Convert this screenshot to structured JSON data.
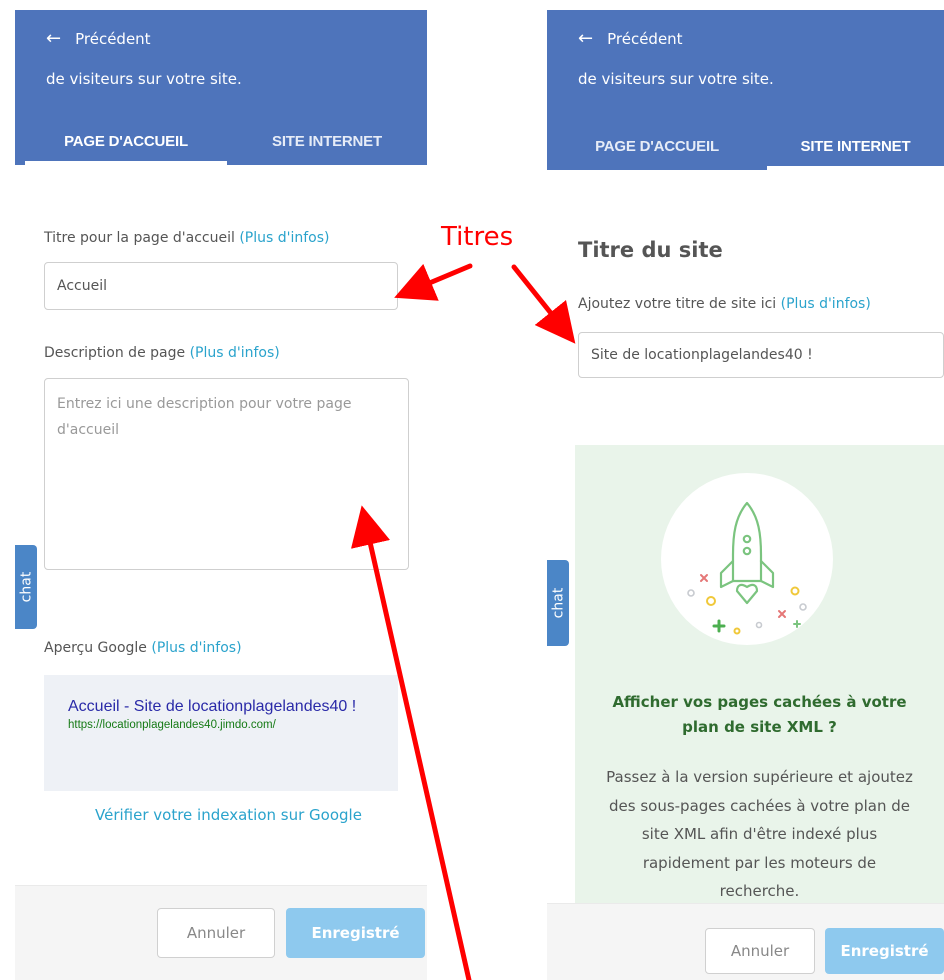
{
  "left": {
    "back_label": "Précédent",
    "header_sub": "de visiteurs sur votre site.",
    "tabs": [
      {
        "label": "PAGE D'ACCUEIL",
        "active": true
      },
      {
        "label": "SITE INTERNET",
        "active": false
      }
    ],
    "title_label": "Titre pour la page d'accueil",
    "more_info": "(Plus d'infos)",
    "title_value": "Accueil",
    "description_label": "Description de page",
    "description_placeholder": "Entrez ici une description pour votre page d'accueil",
    "google_label": "Aperçu Google",
    "google_preview": {
      "title": "Accueil - Site de locationplagelandes40 !",
      "url": "https://locationplagelandes40.jimdo.com/"
    },
    "verify_link": "Vérifier votre indexation sur Google",
    "cancel_label": "Annuler",
    "save_label": "Enregistré"
  },
  "right": {
    "back_label": "Précédent",
    "header_sub": "de visiteurs sur votre site.",
    "tabs": [
      {
        "label": "PAGE D'ACCUEIL",
        "active": false
      },
      {
        "label": "SITE INTERNET",
        "active": true
      }
    ],
    "section_title": "Titre du site",
    "site_title_label": "Ajoutez votre titre de site ici",
    "more_info": "(Plus d'infos)",
    "site_title_value": "Site de locationplagelandes40 !",
    "promo": {
      "title": "Afficher vos pages cachées à votre plan de site XML ?",
      "body": "Passez à la version supérieure et ajoutez des sous-pages cachées à votre plan de site XML afin d'être indexé plus rapidement par les moteurs de recherche."
    },
    "cancel_label": "Annuler",
    "save_label": "Enregistré"
  },
  "chat_label": "chat",
  "annotation": {
    "text": "Titres",
    "color": "#ff0000"
  },
  "colors": {
    "header_blue": "#4e74bb",
    "link": "#2aa3cc",
    "save_button": "#8ec9ee",
    "promo_green": "#2f6b2f"
  }
}
